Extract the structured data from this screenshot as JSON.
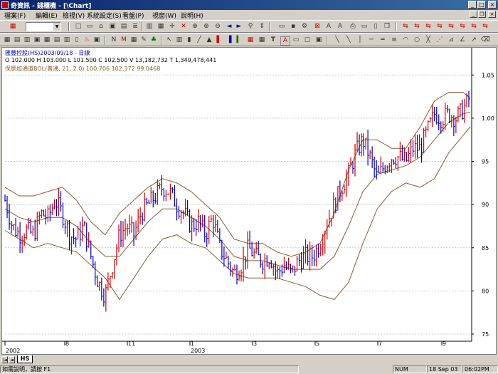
{
  "window": {
    "title": "奇資訊 - 錢櫃機 - [\\Chart]",
    "minimize": "_",
    "maximize": "□",
    "close": "×"
  },
  "menu": [
    "檔案(F)",
    "編輯(E)",
    "檢視(V)",
    "系統設定(S)",
    "看盤(P)",
    "視窗(W)",
    "說明(H)"
  ],
  "toolbar": {
    "combo_value": ""
  },
  "chart": {
    "header_line1": "匯豐控股(HS)2003/09/18 - 日線",
    "header_line2": "O 102.000 H 103.000 L 101.500 C 102.500 V 13,182,732 T 1,349,478,441",
    "header_line3": "保歷加通道BOL(普通, 21, 2.0) 100.706  102.372  99.0468",
    "colors": {
      "up": "#cc0000",
      "down": "#0000cc",
      "band": "#8b5a2b",
      "grid": "#c8c8c8"
    }
  },
  "chart_data": {
    "type": "line",
    "title": "",
    "y_ticks": [
      "75",
      "80",
      "85",
      "90",
      "95",
      "1.00",
      "1.05"
    ],
    "ylim": [
      75,
      107
    ],
    "x_labels": [
      "2002",
      "8",
      "11",
      "1",
      "2003",
      "3",
      "5",
      "7",
      "9"
    ],
    "series": [
      {
        "x": [
          0,
          10,
          20,
          30,
          40,
          50,
          60,
          70,
          80,
          90,
          100,
          110,
          120,
          130,
          140,
          150,
          160,
          170,
          180,
          190,
          200,
          210,
          220,
          230,
          240,
          250,
          260,
          270,
          280,
          290,
          300,
          310,
          320,
          330,
          340,
          350,
          360,
          370,
          380,
          390,
          400,
          410,
          420,
          430,
          440,
          450,
          460,
          470,
          480,
          490,
          500,
          510,
          520,
          530,
          540,
          550,
          560,
          570,
          580,
          590,
          600,
          610,
          620,
          630,
          640,
          650
        ],
        "values": [
          90.5,
          87.5,
          86.5,
          87,
          86.5,
          89,
          88.5,
          90.5,
          89,
          86.5,
          86,
          87.5,
          84,
          81,
          79.5,
          83,
          86.5,
          87.5,
          86.5,
          89,
          90,
          91,
          92,
          91.5,
          90,
          89,
          87.5,
          88,
          86.5,
          88.5,
          85,
          83.5,
          82,
          83,
          85,
          84,
          83.5,
          84,
          82,
          83,
          82,
          83.5,
          84,
          84,
          85.5,
          88,
          90,
          92,
          93.5,
          96,
          97.5,
          95.5,
          93,
          94.5,
          95.5,
          95.5,
          95,
          96.5,
          96.5,
          98.5,
          100.5,
          100,
          100.5,
          100,
          101,
          102.5
        ]
      },
      {
        "x": [
          0,
          20,
          40,
          60,
          80,
          100,
          120,
          140,
          160,
          180,
          200,
          220,
          240,
          260,
          280,
          300,
          320,
          340,
          360,
          380,
          400,
          420,
          440,
          460,
          480,
          500,
          520,
          540,
          560,
          580,
          600,
          620,
          640,
          650
        ],
        "values": [
          92,
          91,
          91,
          91.5,
          92,
          90.5,
          88,
          86.5,
          89,
          90.5,
          92,
          93,
          92.5,
          91.5,
          90,
          88.5,
          86,
          85.5,
          85.5,
          84.5,
          84,
          84.5,
          85.5,
          89,
          94,
          97.5,
          97.5,
          96.5,
          96.5,
          99,
          102,
          103,
          103,
          102.3
        ]
      },
      {
        "x": [
          0,
          20,
          40,
          60,
          80,
          100,
          120,
          140,
          160,
          180,
          200,
          220,
          240,
          260,
          280,
          300,
          320,
          340,
          360,
          380,
          400,
          420,
          440,
          460,
          480,
          500,
          520,
          540,
          560,
          580,
          600,
          620,
          640,
          650
        ],
        "values": [
          89.5,
          88.5,
          88,
          88.5,
          88.5,
          87.5,
          85.5,
          84,
          84,
          86,
          88,
          89.5,
          89.5,
          88.5,
          87.5,
          86,
          84,
          83.5,
          83.5,
          83,
          82.5,
          82.5,
          82.5,
          84,
          87.5,
          91.5,
          93.5,
          94,
          94.5,
          95.5,
          97.5,
          99.5,
          100.5,
          100.7
        ]
      },
      {
        "x": [
          0,
          20,
          40,
          60,
          80,
          100,
          120,
          140,
          160,
          180,
          200,
          220,
          240,
          260,
          280,
          300,
          320,
          340,
          360,
          380,
          400,
          420,
          440,
          460,
          480,
          500,
          520,
          540,
          560,
          580,
          600,
          620,
          640,
          650
        ],
        "values": [
          87,
          86,
          85,
          85.5,
          85,
          84.5,
          83,
          81.5,
          79,
          81.5,
          84,
          86,
          86.5,
          85.5,
          85,
          83.5,
          82,
          81.5,
          81.5,
          81.5,
          81,
          80.5,
          79.5,
          79,
          81,
          85.5,
          89.5,
          91.5,
          92.5,
          92,
          93,
          96,
          98,
          99
        ]
      }
    ]
  },
  "sheet_tabs": {
    "first": "|◄",
    "prev": "◄",
    "active": "HS"
  },
  "status": {
    "help": "如需說明，請按 F1",
    "num": "NUM",
    "date": "18 Sep 03",
    "time": "06:02PM"
  }
}
